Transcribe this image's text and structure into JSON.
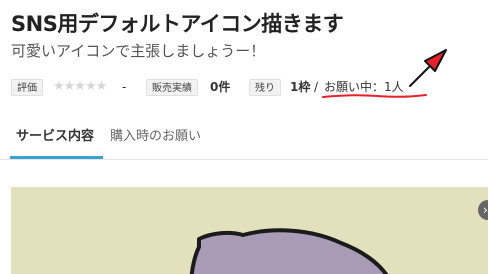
{
  "service": {
    "title": "SNS用デフォルトアイコン描きます",
    "subtitle": "可愛いアイコンで主張しましょうー！"
  },
  "meta": {
    "rating_label": "評価",
    "rating_stars": "★★★★★",
    "rating_value": "-",
    "sales_label": "販売実績",
    "sales_value": "0件",
    "remaining_label": "残り",
    "remaining_value": "1枠",
    "separator": "/",
    "request_status": "お願い中：1人"
  },
  "tabs": {
    "service_content": "サービス内容",
    "purchase_request": "購入時のお願い"
  },
  "colors": {
    "tab_indicator": "#3ea0cf",
    "annotation": "#e8202a",
    "preview_bg": "#e3e1bd",
    "character_fill": "#a99bb5"
  },
  "icons": {
    "arrow": "red-arrow-icon",
    "carousel_next": "chevron-right-icon"
  }
}
